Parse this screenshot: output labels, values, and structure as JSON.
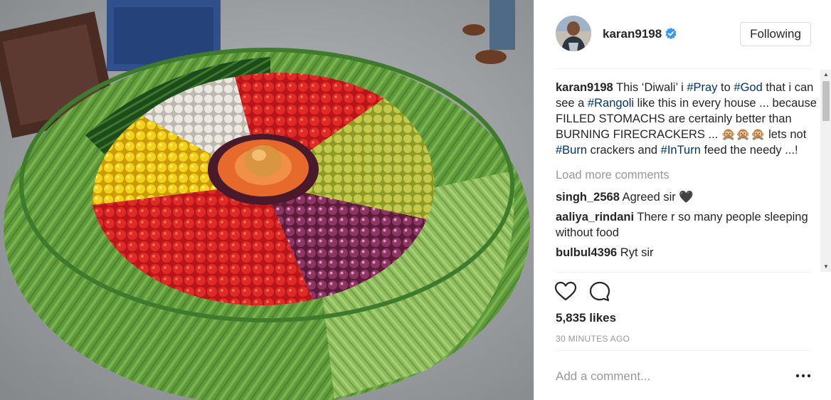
{
  "post": {
    "username": "karan9198",
    "follow_label": "Following",
    "caption": {
      "user": "karan9198",
      "parts": [
        {
          "text": " This ‘Diwali’ i ",
          "tag": false
        },
        {
          "text": "#Pray",
          "tag": true
        },
        {
          "text": " to ",
          "tag": false
        },
        {
          "text": "#God",
          "tag": true
        },
        {
          "text": " that i can see a ",
          "tag": false
        },
        {
          "text": "#Rangoli",
          "tag": true
        },
        {
          "text": " like this in every house ... because FILLED STOMACHS are certainly better than BURNING FIRECRACKERS ... 🙊🙊🙊 lets not ",
          "tag": false
        },
        {
          "text": "#Burn",
          "tag": true
        },
        {
          "text": " crackers and ",
          "tag": false
        },
        {
          "text": "#InTurn",
          "tag": true
        },
        {
          "text": " feed the needy ...!",
          "tag": false
        }
      ]
    },
    "load_more_label": "Load more comments",
    "comments": [
      {
        "user": "singh_2568",
        "text": "Agreed sir 🖤"
      },
      {
        "user": "aaliya_rindani",
        "text": "There r so many people sleeping without food"
      },
      {
        "user": "bulbul4396",
        "text": "Ryt sir"
      }
    ],
    "likes": "5,835 likes",
    "timestamp": "30 MINUTES AGO",
    "comment_placeholder": "Add a comment...",
    "more_label": "•••"
  },
  "icons": {
    "verified": "verified-badge-icon",
    "like": "heart-icon",
    "comment": "comment-bubble-icon",
    "options": "more-options-icon"
  },
  "colors": {
    "hashtag": "#003569",
    "muted": "#999999",
    "verified": "#3897f0",
    "text": "#262626"
  }
}
